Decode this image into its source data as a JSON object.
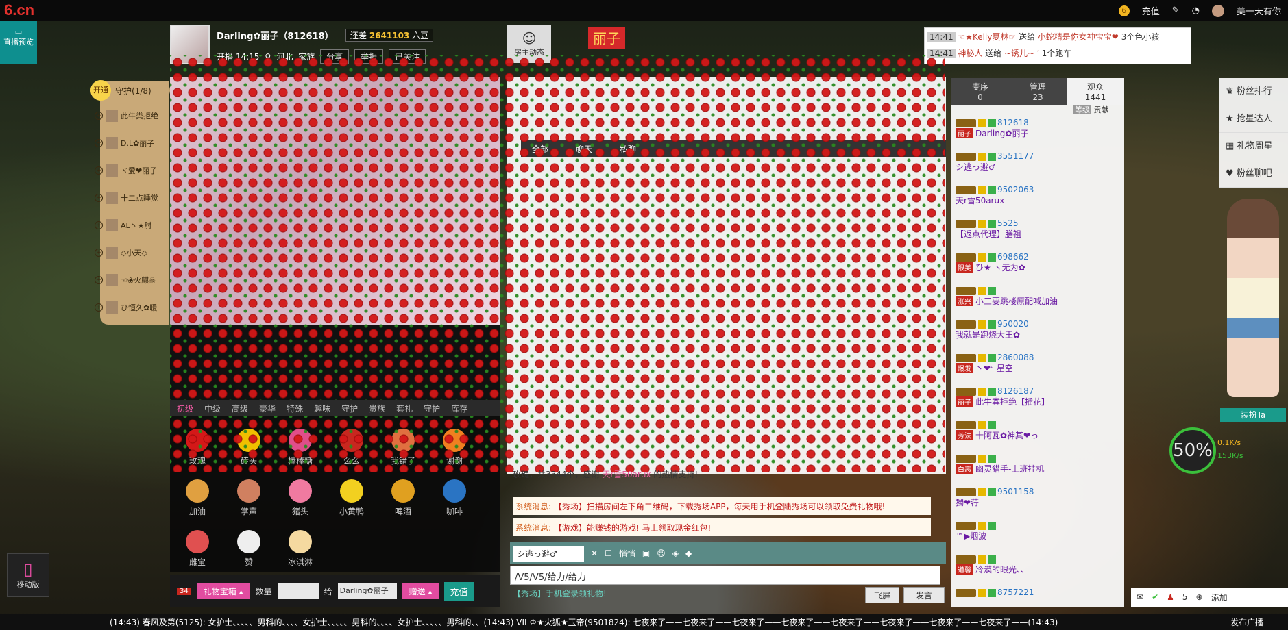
{
  "topbar": {
    "logo": "6.cn",
    "recharge": "充值",
    "user": "美一天有你"
  },
  "preview": "直播预览",
  "anchor": {
    "name": "Darling✿丽子（812618）",
    "owe_label": "还差",
    "owe_value": "2641103",
    "owe_unit": "六豆",
    "start": "开播 14:15",
    "location": "河北",
    "family": "家族",
    "share": "分享",
    "report": "举报",
    "followed": "已关注"
  },
  "host_btn": "房主动态",
  "flag": "丽子",
  "guard": {
    "open": "开通",
    "title": "守护(1/8)",
    "items": [
      "此牛粪拒绝",
      "D.L✿丽子",
      "ヾ爱❤丽子",
      "十二点睡觉",
      "AL丶★肘",
      "◇小天◇",
      "☜❀火麒☠",
      "ひ恒久✿暖"
    ]
  },
  "gift_tabs": [
    "初级",
    "中级",
    "高级",
    "豪华",
    "特殊",
    "趣味",
    "守护",
    "贵族",
    "套礼",
    "守护",
    "库存"
  ],
  "gifts": [
    "玫瑰",
    "砖头",
    "棒棒糖",
    "么么",
    "我错了",
    "谢谢",
    "加油",
    "掌声",
    "猪头",
    "小黄鸭",
    "啤酒",
    "咖啡",
    "雌宝",
    "赞",
    "冰淇淋"
  ],
  "sendbar": {
    "box": "礼物宝箱",
    "count_label": "数量",
    "to_label": "给",
    "to": "Darling✿丽子",
    "send": "赠送",
    "recharge": "充值",
    "badge": "34"
  },
  "chat_tabs": [
    "全部",
    "聊天",
    "私聊"
  ],
  "chat_line": {
    "text": "玫瑰，共3344个，感谢",
    "user": "天r雪50arux",
    "end": "的热情支持!"
  },
  "sys": [
    {
      "label": "系统消息:",
      "text": "【秀场】扫描房间左下角二维码，下载秀场APP，每天用手机登陆秀场可以领取免费礼物哦!"
    },
    {
      "label": "系统消息:",
      "text": "【游戏】能赚钱的游戏! 马上领取现金红包!"
    }
  ],
  "chatctl": {
    "target": "シ逃っ避♂",
    "quiet": "悄悄"
  },
  "input": "/V5/V5/给力/给力",
  "hint": "【秀场】手机登录领礼物!",
  "fly": "飞屏",
  "say": "发言",
  "utabs": [
    {
      "l": "麦序",
      "n": "0"
    },
    {
      "l": "管理",
      "n": "23"
    },
    {
      "l": "观众",
      "n": "1441"
    }
  ],
  "ulist_sub": [
    "等级",
    "贡献"
  ],
  "users": [
    {
      "id": "812618",
      "nm": "Darling✿丽子",
      "tag": "丽子"
    },
    {
      "id": "3551177",
      "nm": "シ逃っ避♂",
      "tag": ""
    },
    {
      "id": "9502063",
      "nm": "天r雪50arux",
      "tag": ""
    },
    {
      "id": "5525",
      "nm": "【返点代理】膳祖",
      "tag": ""
    },
    {
      "id": "698662",
      "nm": "ひ★ ヽ无为✿",
      "tag": "限美"
    },
    {
      "id": "",
      "nm": "小三要跳楼原配喊加油",
      "tag": "涨兴"
    },
    {
      "id": "950020",
      "nm": "我就是跑烧大王✿",
      "tag": ""
    },
    {
      "id": "2860088",
      "nm": "丶❤ᵛ 星空",
      "tag": "爆发"
    },
    {
      "id": "8126187",
      "nm": "此牛粪拒绝【插花】",
      "tag": "丽子"
    },
    {
      "id": "",
      "nm": "十阿瓦✿神其❤っ",
      "tag": "芳法"
    },
    {
      "id": "",
      "nm": "幽灵猎手-上班挂机",
      "tag": "白恶"
    },
    {
      "id": "9501158",
      "nm": "獨❤荇",
      "tag": ""
    },
    {
      "id": "",
      "nm": "™▶烟波",
      "tag": ""
    },
    {
      "id": "",
      "nm": "冷漠的眼光、、",
      "tag": "道馨"
    },
    {
      "id": "8757221",
      "nm": "",
      "tag": ""
    }
  ],
  "toasts": [
    {
      "t": "14:41",
      "a": "☜★Kelly夏林☞",
      "v": "送给",
      "b": "小蛇精是你女神宝宝❤",
      "c": "3个色小孩"
    },
    {
      "t": "14:41",
      "a": "神秘人",
      "v": "送给",
      "b": "~诱儿~ ′",
      "c": "1个跑车"
    }
  ],
  "rside": [
    "粉丝排行",
    "抢星达人",
    "礼物周星",
    "粉丝聊吧"
  ],
  "dress": "装扮Ta",
  "gauge": "50%",
  "speed": [
    "0.1K/s",
    "153K/s"
  ],
  "mobile": "移动版",
  "bottom": {
    "count": "5",
    "add": "添加"
  },
  "ticker": "(14:43)  春风及第(5125):  女护士、、、、、男科的、、、、女护士、、、、、男科的、、、、女护士、、、、、男科的、、(14:43)   VII ♔★火狐★玉帝(9501824):  七夜来了——七夜来了——七夜来了——七夜来了——七夜来了——七夜来了——七夜来了——七夜来了——(14:43)",
  "broadcast": "发布广播",
  "colors": {
    "accent": "#1a9b8b",
    "pink": "#e24ca0",
    "red": "#d41818"
  }
}
